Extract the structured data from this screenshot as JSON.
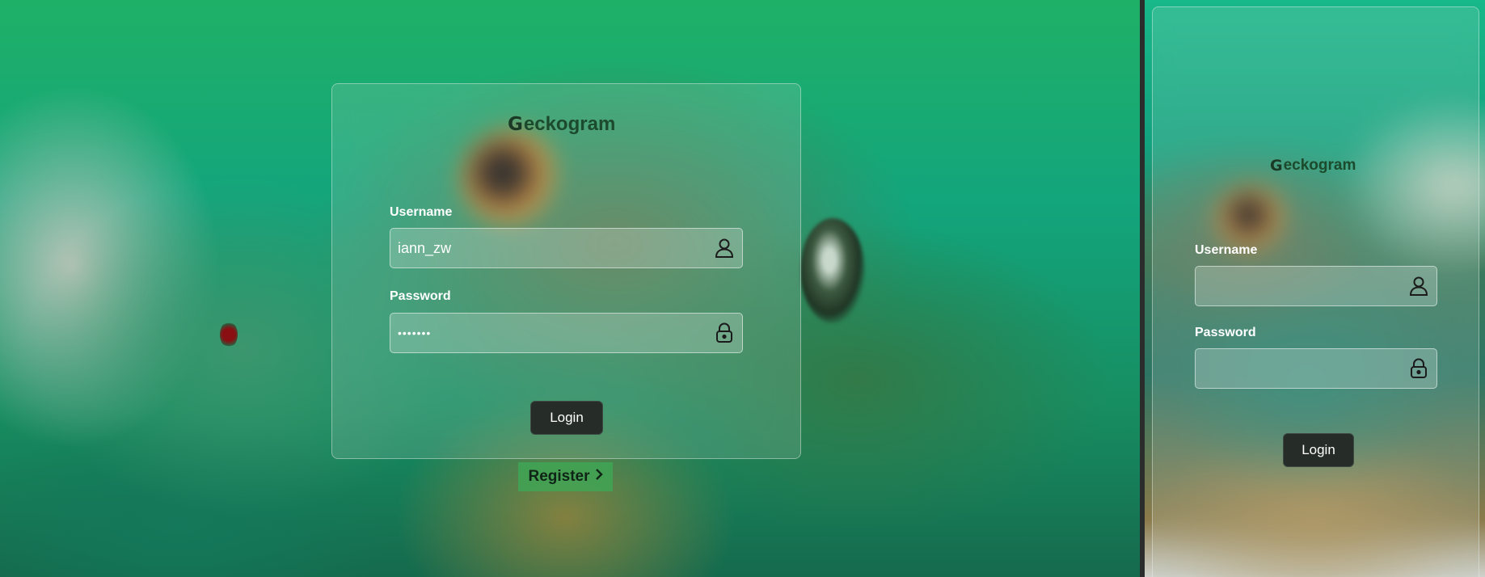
{
  "brand": {
    "name": "eckogram",
    "icon_name": "gecko-logo-icon",
    "icon_glyph": "G"
  },
  "desktop": {
    "username": {
      "label": "Username",
      "value": "iann_zw",
      "icon": "user-icon"
    },
    "password": {
      "label": "Password",
      "value": "•••••••",
      "icon": "lock-icon"
    },
    "login_label": "Login",
    "register_label": "Register",
    "register_icon": "chevron-right-icon"
  },
  "mobile": {
    "username": {
      "label": "Username",
      "value": "",
      "icon": "user-icon"
    },
    "password": {
      "label": "Password",
      "value": "",
      "icon": "lock-icon"
    },
    "login_label": "Login"
  },
  "colors": {
    "background_green": "#13a57c",
    "brand_text": "#1c4a2c",
    "button_bg": "#262d29",
    "register_bg": "#3caa55"
  }
}
